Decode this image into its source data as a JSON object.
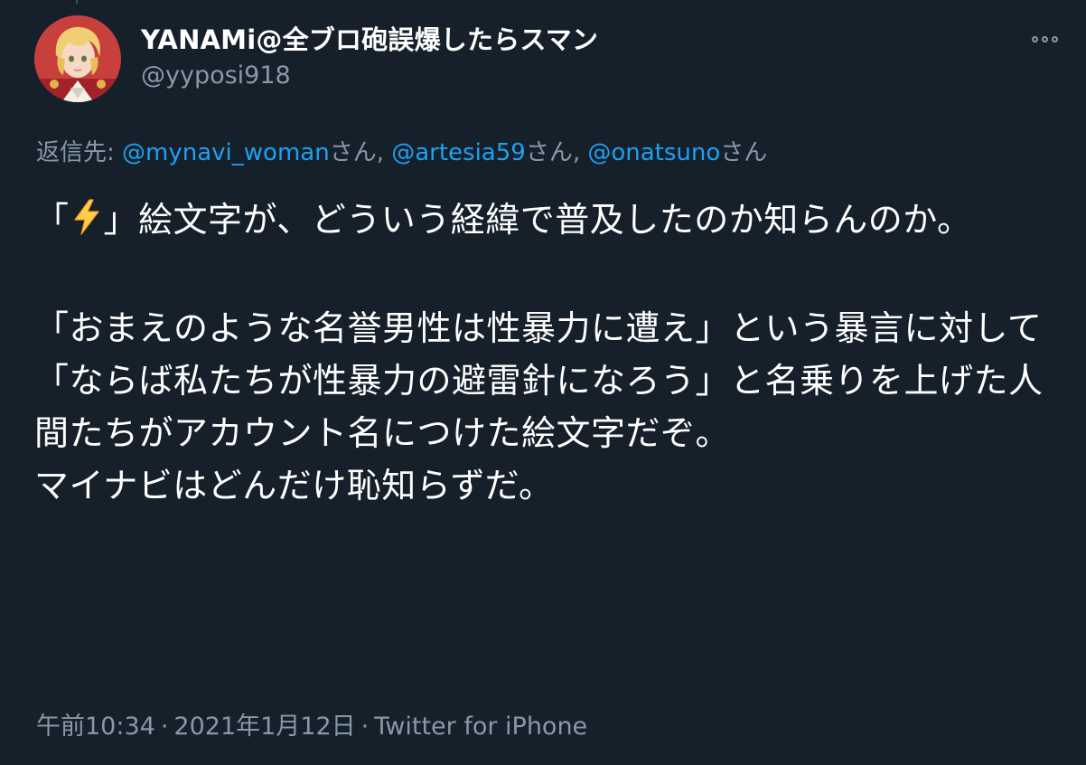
{
  "tweet": {
    "author": {
      "display_name": "YANAMi@全ブロ砲誤爆したらスマン",
      "handle": "@yyposi918",
      "avatar_icon": "avatar-illustration"
    },
    "more_icon": "more-options-icon",
    "reply_to": {
      "prefix": "返信先:",
      "mentions": [
        {
          "handle": "@mynavi_woman",
          "suffix": "さん,"
        },
        {
          "handle": "@artesia59",
          "suffix": "さん,"
        },
        {
          "handle": "@onatsuno",
          "suffix": "さん"
        }
      ]
    },
    "text": {
      "open_quote": "「",
      "emoji": "⚡",
      "body": "」絵文字が、どういう経緯で普及したのか知らんのか。\n\n「おまえのような名誉男性は性暴力に遭え」という暴言に対して\n「ならば私たちが性暴力の避雷針になろう」と名乗りを上げた人間たちがアカウント名につけた絵文字だぞ。\nマイナビはどんだけ恥知らずだ。"
    },
    "meta": {
      "time": "午前10:34",
      "separator": "·",
      "date": "2021年1月12日",
      "source": "Twitter for iPhone"
    }
  },
  "colors": {
    "background": "#15202b",
    "primary_text": "#ffffff",
    "secondary_text": "#8899a6",
    "link": "#1da1f2",
    "emoji_bolt": "#ffcc4d"
  }
}
